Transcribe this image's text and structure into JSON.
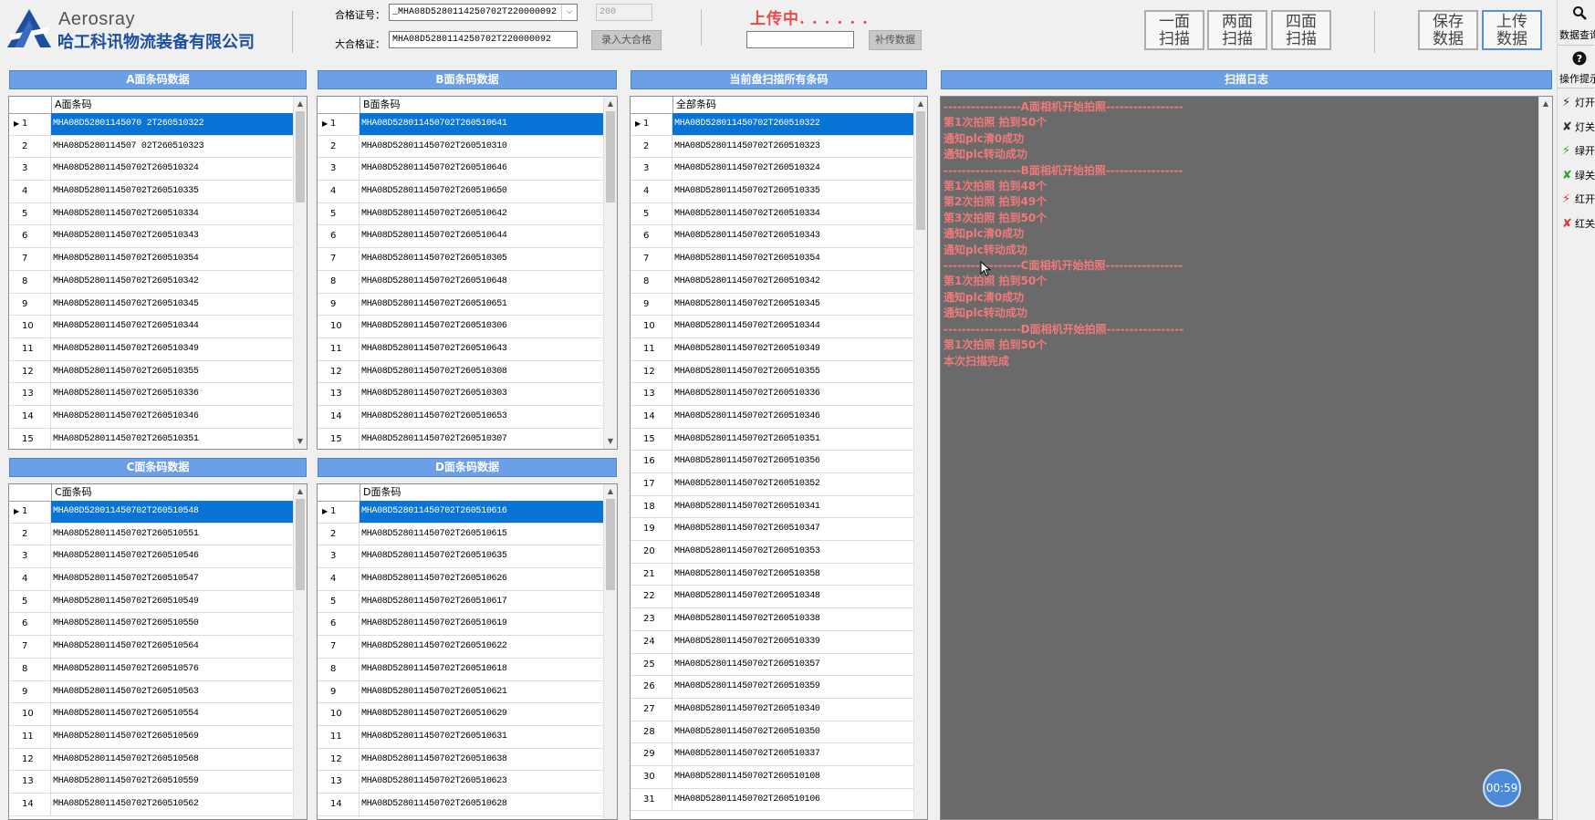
{
  "header": {
    "brand_en": "Aerosray",
    "brand_cn": "哈工科讯物流装备有限公司",
    "cert_label": "合格证号：",
    "cert_value": "_MHA08D5280114250702T220000092",
    "count_value": "200",
    "big_cert_label": "大合格证：",
    "big_cert_value": "MHA08D5280114250702T220000092",
    "enter_big_button": "录入大合格",
    "upload_status": "上传中. . . . . .",
    "supplement_input": "",
    "supplement_button": "补传数据",
    "scan_buttons": [
      {
        "line1": "一面",
        "line2": "扫描"
      },
      {
        "line1": "两面",
        "line2": "扫描"
      },
      {
        "line1": "四面",
        "line2": "扫描"
      }
    ],
    "save_button": {
      "line1": "保存",
      "line2": "数据"
    },
    "upload_button": {
      "line1": "上传",
      "line2": "数据"
    }
  },
  "tools": {
    "query_label": "数据查询",
    "help_label": "操作提示",
    "items": [
      {
        "label": "灯开",
        "icon": "bolt-icon",
        "color": "#333333"
      },
      {
        "label": "灯关",
        "icon": "bolt-off-icon",
        "color": "#333333"
      },
      {
        "label": "绿开",
        "icon": "bolt-icon",
        "color": "#2fa52f"
      },
      {
        "label": "绿关",
        "icon": "bolt-off-icon",
        "color": "#2fa52f"
      },
      {
        "label": "红开",
        "icon": "bolt-icon",
        "color": "#d63a3a"
      },
      {
        "label": "红关",
        "icon": "bolt-off-icon",
        "color": "#d63a3a"
      }
    ]
  },
  "panels": {
    "a": {
      "title": "A面条码数据",
      "column": "A面条码",
      "rows": [
        "MHA08D52801145070 2T260510322",
        "MHA08D5280114507 02T260510323",
        "MHA08D528011450702T260510324",
        "MHA08D528011450702T260510335",
        "MHA08D528011450702T260510334",
        "MHA08D528011450702T260510343",
        "MHA08D528011450702T260510354",
        "MHA08D528011450702T260510342",
        "MHA08D528011450702T260510345",
        "MHA08D528011450702T260510344",
        "MHA08D528011450702T260510349",
        "MHA08D528011450702T260510355",
        "MHA08D528011450702T260510336",
        "MHA08D528011450702T260510346",
        "MHA08D528011450702T260510351"
      ]
    },
    "b": {
      "title": "B面条码数据",
      "column": "B面条码",
      "rows": [
        "MHA08D528011450702T260510641",
        "MHA08D528011450702T260510310",
        "MHA08D528011450702T260510646",
        "MHA08D528011450702T260510650",
        "MHA08D528011450702T260510642",
        "MHA08D528011450702T260510644",
        "MHA08D528011450702T260510305",
        "MHA08D528011450702T260510648",
        "MHA08D528011450702T260510651",
        "MHA08D528011450702T260510306",
        "MHA08D528011450702T260510643",
        "MHA08D528011450702T260510308",
        "MHA08D528011450702T260510303",
        "MHA08D528011450702T260510653",
        "MHA08D528011450702T260510307"
      ]
    },
    "all": {
      "title": "当前盘扫描所有条码",
      "column": "全部条码",
      "rows": [
        "MHA08D528011450702T260510322",
        "MHA08D528011450702T260510323",
        "MHA08D528011450702T260510324",
        "MHA08D528011450702T260510335",
        "MHA08D528011450702T260510334",
        "MHA08D528011450702T260510343",
        "MHA08D528011450702T260510354",
        "MHA08D528011450702T260510342",
        "MHA08D528011450702T260510345",
        "MHA08D528011450702T260510344",
        "MHA08D528011450702T260510349",
        "MHA08D528011450702T260510355",
        "MHA08D528011450702T260510336",
        "MHA08D528011450702T260510346",
        "MHA08D528011450702T260510351",
        "MHA08D528011450702T260510356",
        "MHA08D528011450702T260510352",
        "MHA08D528011450702T260510341",
        "MHA08D528011450702T260510347",
        "MHA08D528011450702T260510353",
        "MHA08D528011450702T260510358",
        "MHA08D528011450702T260510348",
        "MHA08D528011450702T260510338",
        "MHA08D528011450702T260510339",
        "MHA08D528011450702T260510357",
        "MHA08D528011450702T260510359",
        "MHA08D528011450702T260510340",
        "MHA08D528011450702T260510350",
        "MHA08D528011450702T260510337",
        "MHA08D528011450702T260510108",
        "MHA08D528011450702T260510106"
      ]
    },
    "c": {
      "title": "C面条码数据",
      "column": "C面条码",
      "rows": [
        "MHA08D528011450702T260510548",
        "MHA08D528011450702T260510551",
        "MHA08D528011450702T260510546",
        "MHA08D528011450702T260510547",
        "MHA08D528011450702T260510549",
        "MHA08D528011450702T260510550",
        "MHA08D528011450702T260510564",
        "MHA08D528011450702T260510576",
        "MHA08D528011450702T260510563",
        "MHA08D528011450702T260510554",
        "MHA08D528011450702T260510569",
        "MHA08D528011450702T260510568",
        "MHA08D528011450702T260510559",
        "MHA08D528011450702T260510562"
      ]
    },
    "d": {
      "title": "D面条码数据",
      "column": "D面条码",
      "rows": [
        "MHA08D528011450702T260510616",
        "MHA08D528011450702T260510615",
        "MHA08D528011450702T260510635",
        "MHA08D528011450702T260510626",
        "MHA08D528011450702T260510617",
        "MHA08D528011450702T260510619",
        "MHA08D528011450702T260510622",
        "MHA08D528011450702T260510618",
        "MHA08D528011450702T260510621",
        "MHA08D528011450702T260510629",
        "MHA08D528011450702T260510631",
        "MHA08D528011450702T260510638",
        "MHA08D528011450702T260510623",
        "MHA08D528011450702T260510628"
      ]
    }
  },
  "log": {
    "title": "扫描日志",
    "lines": [
      "-----------------A面相机开始拍照-----------------",
      "第1次拍照  拍到50个",
      "通知plc清0成功",
      "通知plc转动成功",
      "-----------------B面相机开始拍照-----------------",
      "第1次拍照  拍到48个",
      "第2次拍照  拍到49个",
      "第3次拍照  拍到50个",
      "通知plc清0成功",
      "通知plc转动成功",
      "-----------------C面相机开始拍照-----------------",
      "第1次拍照  拍到50个",
      "通知plc清0成功",
      "通知plc转动成功",
      "-----------------D面相机开始拍照-----------------",
      "第1次拍照  拍到50个",
      "本次扫描完成"
    ]
  },
  "timer": "00:59"
}
